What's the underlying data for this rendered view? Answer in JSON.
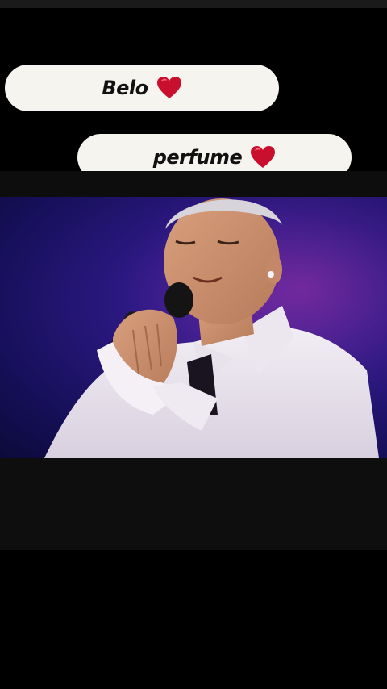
{
  "captions": [
    {
      "text": "Belo",
      "icon": "red-heart-icon"
    },
    {
      "text": "perfume",
      "icon": "red-heart-icon"
    }
  ],
  "colors": {
    "pill_background": "#f6f4ef",
    "heart": "#c8102e",
    "stage_light": "#2a1880"
  },
  "video": {
    "content": "singer-performing-with-microphone"
  }
}
